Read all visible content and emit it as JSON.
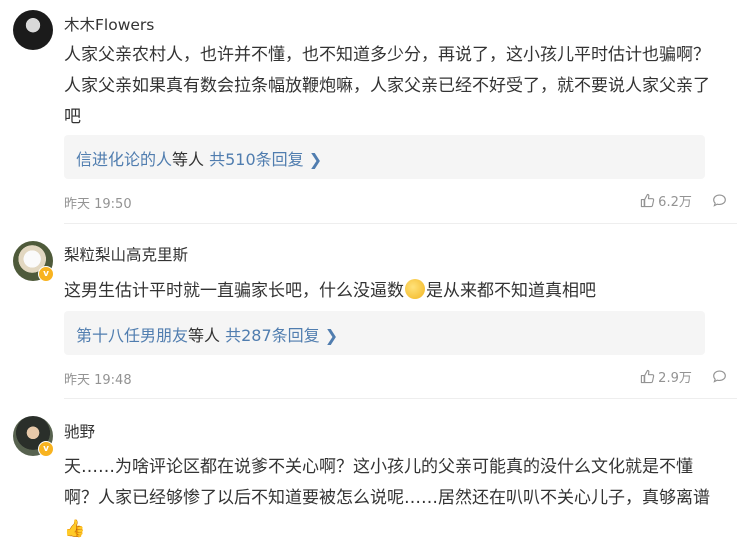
{
  "comments": [
    {
      "username": "木木Flowers",
      "text": "人家父亲农村人，也许并不懂，也不知道多少分，再说了，这小孩儿平时估计也骗啊？人家父亲如果真有数会拉条幅放鞭炮嘛，人家父亲已经不好受了，就不要说人家父亲了吧",
      "reply_user": "信进化论的人",
      "reply_mid": "等人",
      "reply_count": "共510条回复",
      "chevron": "❯",
      "time": "昨天 19:50",
      "likes": "6.2万"
    },
    {
      "username": "梨粒梨山高克里斯",
      "text_a": "这男生估计平时就一直骗家长吧，什么没逼数",
      "text_b": "是从来都不知道真相吧",
      "reply_user": "第十八任男朋友",
      "reply_mid": "等人",
      "reply_count": "共287条回复",
      "chevron": "❯",
      "time": "昨天 19:48",
      "likes": "2.9万"
    },
    {
      "username": "驰野",
      "text": "天……为啥评论区都在说爹不关心啊？这小孩儿的父亲可能真的没什么文化就是不懂啊？人家已经够惨了以后不知道要被怎么说呢……居然还在叭叭不关心儿子，真够离谱",
      "tail_emoji": "👍"
    }
  ],
  "badge_letter": "v",
  "icons": {
    "like": "thumbs-up-icon",
    "comment": "comment-bubble-icon",
    "verified": "verified-badge-icon",
    "emoji": "smiley-emoji-icon"
  }
}
